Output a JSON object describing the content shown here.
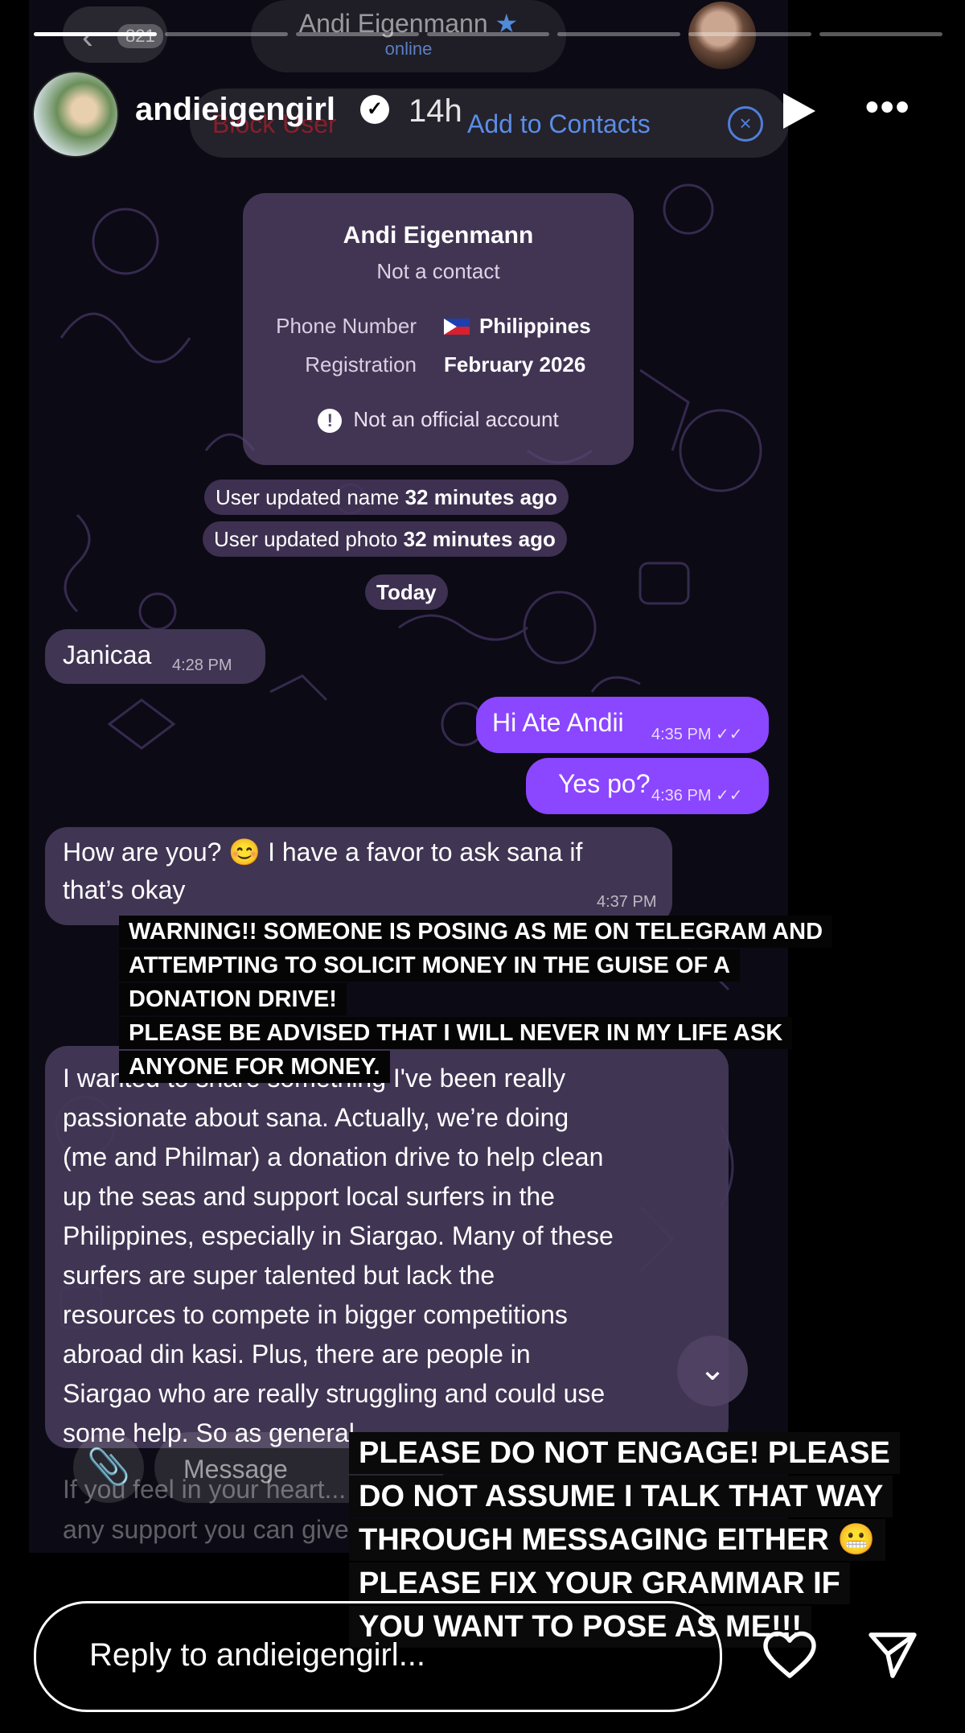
{
  "story": {
    "progress": [
      1.0,
      0,
      0,
      0,
      0,
      0,
      0
    ],
    "username": "andieigengirl",
    "time_ago": "14h",
    "reply_placeholder": "Reply to andieigengirl..."
  },
  "telegram": {
    "back_count": "821",
    "contact_name": "Andi Eigenmann",
    "status": "online",
    "block_label": "Block User",
    "add_label": "Add to Contacts",
    "card": {
      "name": "Andi Eigenmann",
      "subtitle": "Not a contact",
      "phone_label": "Phone Number",
      "phone_value": "Philippines",
      "reg_label": "Registration",
      "reg_value": "February 2026",
      "warning": "Not an official account"
    },
    "system": {
      "name_update_prefix": "User updated name ",
      "name_update_time": "32 minutes ago",
      "photo_update_prefix": "User updated photo ",
      "photo_update_time": "32 minutes ago",
      "date": "Today"
    },
    "messages": [
      {
        "text": "Janicaa",
        "time": "4:28 PM"
      },
      {
        "text": "Hi Ate Andii",
        "time": "4:35 PM"
      },
      {
        "text": "Yes po?",
        "time": "4:36 PM"
      },
      {
        "text_line1": "How are you? 😊 I have a favor to ask sana if",
        "text_line2": "that’s okay",
        "time": "4:37 PM"
      },
      {
        "lines": [
          "I wanted to share something I've been really",
          "passionate about sana. Actually, we’re doing",
          "(me and Philmar) a donation drive to help clean",
          "up the seas and support local surfers in the",
          "Philippines, especially in Siargao. Many of these",
          "surfers are super talented but lack the",
          "resources to compete in bigger competitions",
          "abroad din kasi. Plus, there are people in",
          "Siargao who are really struggling and could use",
          "some help. So as general..."
        ]
      }
    ],
    "behind_text": [
      "If you feel in your heart...",
      "any support you can give"
    ],
    "message_placeholder": "Message"
  },
  "stickers": {
    "warning": [
      "WARNING!! SOMEONE IS POSING AS ME ON TELEGRAM AND",
      "ATTEMPTING TO SOLICIT MONEY IN THE GUISE OF A",
      "DONATION DRIVE!",
      "PLEASE BE ADVISED THAT I WILL NEVER IN MY LIFE ASK",
      "ANYONE FOR MONEY."
    ],
    "engage": [
      "PLEASE DO NOT ENGAGE! PLEASE",
      "DO NOT ASSUME I TALK THAT WAY",
      "THROUGH MESSAGING EITHER 😬",
      "PLEASE FIX YOUR GRAMMAR IF",
      "YOU WANT TO POSE AS ME!!!"
    ]
  },
  "colors": {
    "bubble_out": "#8b46ff",
    "bubble_in": "#463a5a",
    "link_blue": "#5b8de6",
    "block_red": "#b31e2a"
  }
}
